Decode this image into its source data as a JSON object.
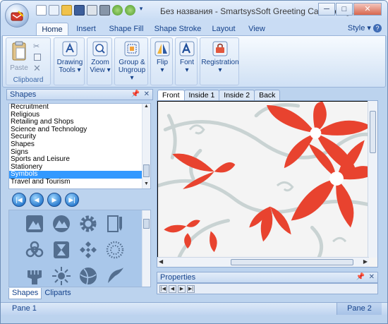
{
  "window": {
    "title": "Без названия - SmartsysSoft Greeting Card Desig...",
    "minimize_label": "─",
    "maximize_label": "□",
    "close_label": "✕"
  },
  "ribbon": {
    "tabs": [
      "Home",
      "Insert",
      "Shape Fill",
      "Shape Stroke",
      "Layout",
      "View"
    ],
    "style_label": "Style ▾",
    "clipboard": {
      "paste_label": "Paste",
      "group_label": "Clipboard"
    },
    "buttons": {
      "drawing_tools": [
        "Drawing",
        "Tools ▾"
      ],
      "zoom_view": [
        "Zoom",
        "View ▾"
      ],
      "group_ungroup": [
        "Group &",
        "Ungroup ▾"
      ],
      "flip": [
        "Flip",
        "▾"
      ],
      "font": [
        "Font",
        "▾"
      ],
      "registration": [
        "Registration",
        "▾"
      ]
    }
  },
  "shapes_panel": {
    "title": "Shapes",
    "categories": [
      "Recruitment",
      "Religious",
      "Retailing and Shops",
      "Science and Technology",
      "Security",
      "Shapes",
      "Signs",
      "Sports and Leisure",
      "Stationery",
      "Symbols",
      "Travel and Tourism"
    ],
    "selected_category": "Symbols",
    "bottom_tabs": [
      "Shapes",
      "Cliparts"
    ]
  },
  "canvas": {
    "tabs": [
      "Front",
      "Inside 1",
      "Inside 2",
      "Back"
    ],
    "active_tab": "Front",
    "colors": {
      "flower": "#e8432f",
      "vine": "#c9d3d3",
      "background": "#f4f4f4"
    }
  },
  "properties_panel": {
    "title": "Properties"
  },
  "status": {
    "left": "Pane 1",
    "right": "Pane 2"
  },
  "colors": {
    "accent": "#15428b",
    "frame": "#bcd3ee",
    "selection": "#3399ff"
  }
}
